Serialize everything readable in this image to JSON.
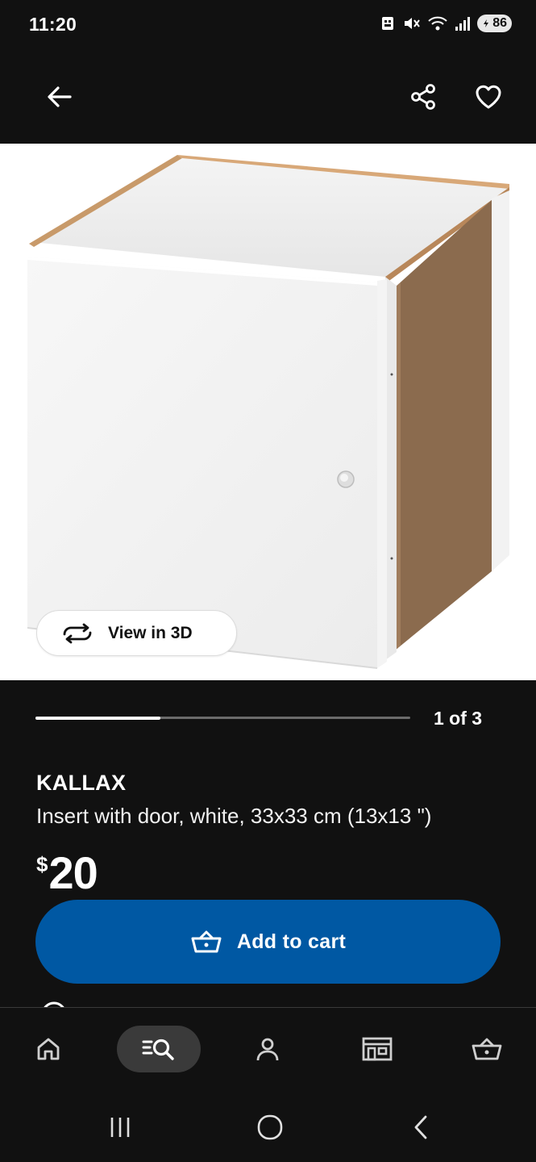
{
  "status_bar": {
    "time": "11:20",
    "battery_level": "86",
    "icons": [
      "notification-icon",
      "mute-icon",
      "wifi-icon",
      "signal-icon",
      "battery-icon"
    ]
  },
  "top_nav": {
    "icons": [
      "back-arrow-icon",
      "share-icon",
      "heart-icon"
    ]
  },
  "product_image": {
    "view_3d_label": "View in 3D",
    "view_3d_icon": "rotate-3d-icon"
  },
  "carousel": {
    "counter": "1 of 3",
    "current": 1,
    "total": 3
  },
  "product": {
    "name": "KALLAX",
    "description": "Insert with door, white, 33x33 cm (13x13 \")",
    "currency": "$",
    "price": "20"
  },
  "cart_button": {
    "label": "Add to cart",
    "icon": "basket-icon",
    "color": "#0058a3"
  },
  "tab_bar": {
    "tabs": [
      "home-icon",
      "search-icon",
      "profile-icon",
      "stores-icon",
      "cart-icon"
    ],
    "active": "search-icon"
  },
  "system_nav": {
    "buttons": [
      "recents-icon",
      "home-circle-icon",
      "back-chevron-icon"
    ]
  },
  "colors": {
    "background": "#111111",
    "brand_blue": "#0058a3",
    "active_tab": "#3a3a3a"
  }
}
